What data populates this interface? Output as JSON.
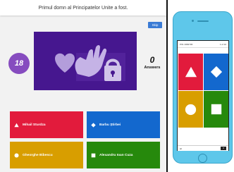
{
  "game": {
    "question": "Primul domn al Principatelor Unite a fost.",
    "skip_label": "Skip",
    "timer": "18",
    "answers_count": "0",
    "answers_label": "Answers"
  },
  "answers": [
    {
      "label": "Mihail Sturdza",
      "color": "#e21b3c",
      "shape": "triangle"
    },
    {
      "label": "Barbu Știrbei",
      "color": "#1368ce",
      "shape": "diamond"
    },
    {
      "label": "Gheorghe Bibescu",
      "color": "#d89e00",
      "shape": "circle"
    },
    {
      "label": "Alexandru Ioan Cuza",
      "color": "#26890c",
      "shape": "square"
    }
  ],
  "phone": {
    "header_left": "PIN: 0082706",
    "header_right": "1 of 10",
    "footer_left": "Al",
    "footer_score": "0"
  },
  "icons": [
    "triangle-icon",
    "diamond-icon",
    "circle-icon",
    "square-icon",
    "hands-heart-icon"
  ]
}
